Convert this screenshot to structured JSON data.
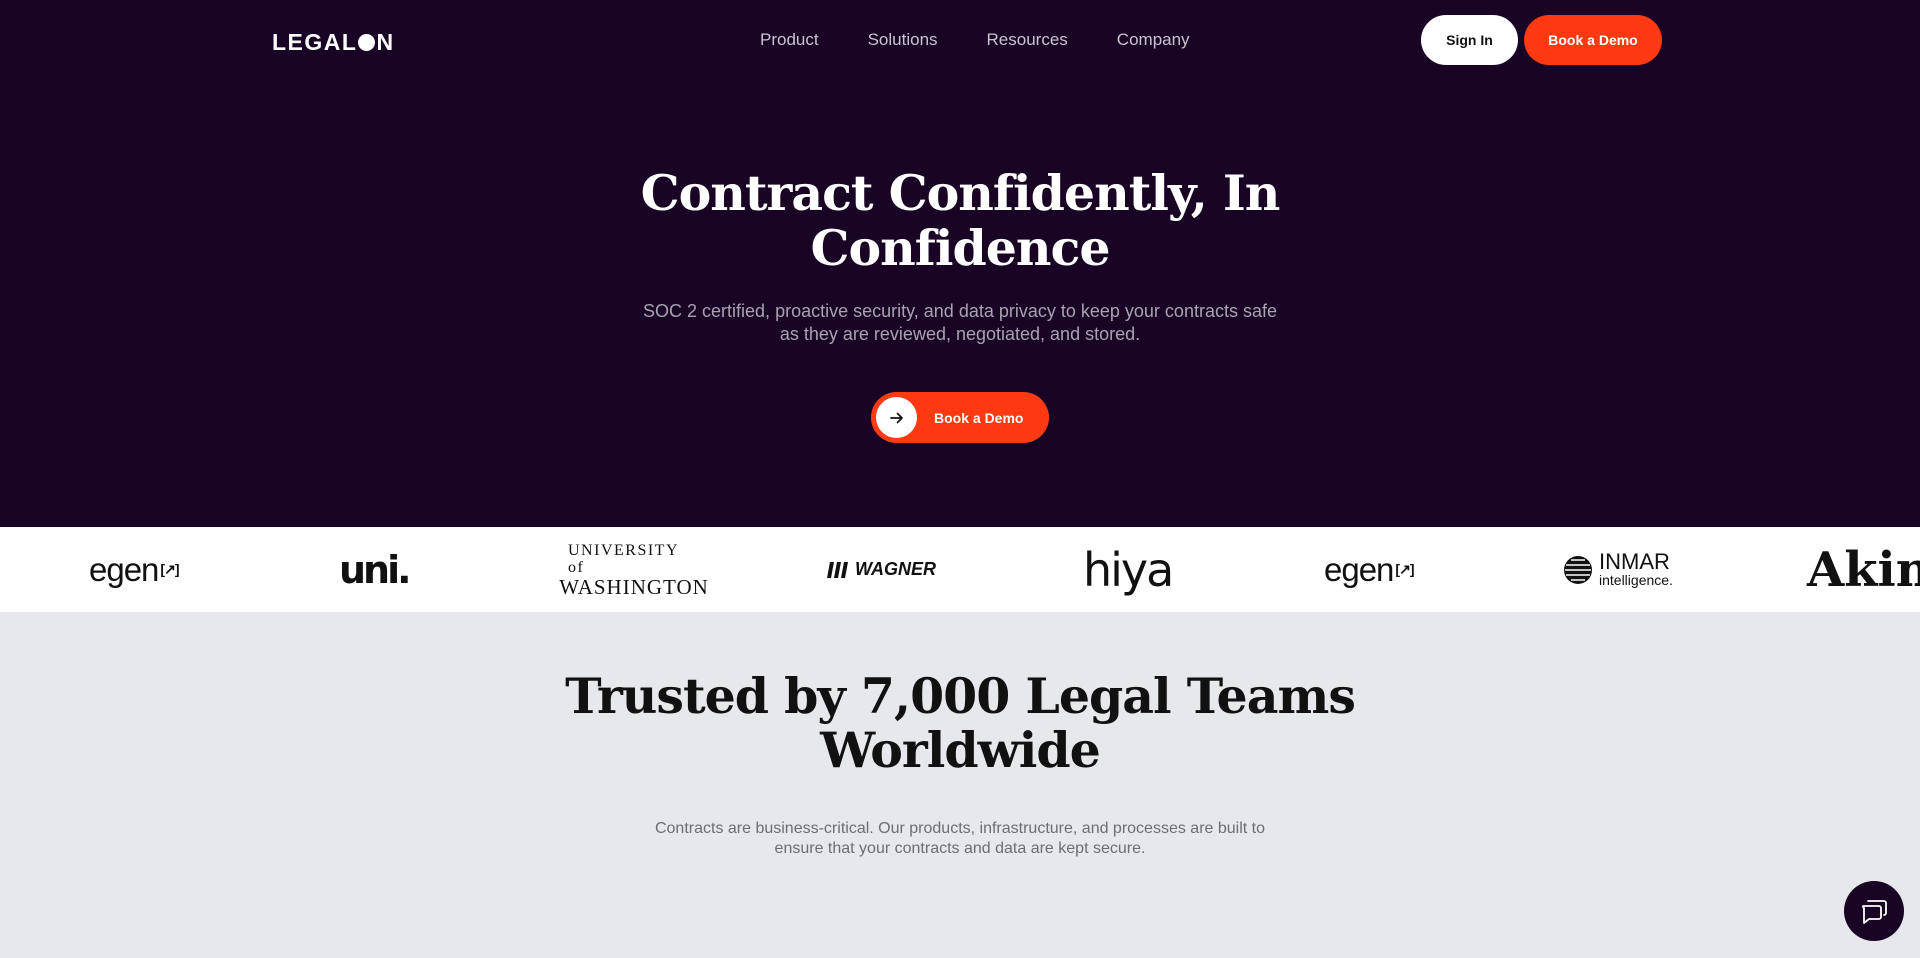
{
  "nav": {
    "logo_text_left": "LEGAL",
    "logo_text_right": "N",
    "links": [
      "Product",
      "Solutions",
      "Resources",
      "Company"
    ],
    "sign_in_label": "Sign In",
    "demo_label": "Book a Demo"
  },
  "hero": {
    "title": "Contract Confidently, In Confidence",
    "subtitle": "SOC 2 certified, proactive security, and data privacy to keep your contracts safe as they are reviewed, negotiated, and stored.",
    "cta_label": "Book a Demo",
    "cta_icon": "arrow-right-icon"
  },
  "logo_strip": {
    "egen": "egen",
    "egen_mark": "[↗]",
    "uni": "uni.",
    "uw_line1": "UNIVERSITY of",
    "uw_line2": "WASHINGTON",
    "wagner": "WAGNER",
    "hiya": "hiya",
    "inmar_line1": "INMAR",
    "inmar_line2": "intelligence.",
    "akin": "Akin"
  },
  "trust": {
    "title": "Trusted by 7,000 Legal Teams Worldwide",
    "subtitle": "Contracts are business-critical. Our products, infrastructure, and processes are built to ensure that your contracts and data are kept secure."
  },
  "chat": {
    "icon": "chat-icon"
  },
  "colors": {
    "hero_bg": "#1a0426",
    "accent": "#ff3a12",
    "page_bg": "#e7e8ec"
  }
}
